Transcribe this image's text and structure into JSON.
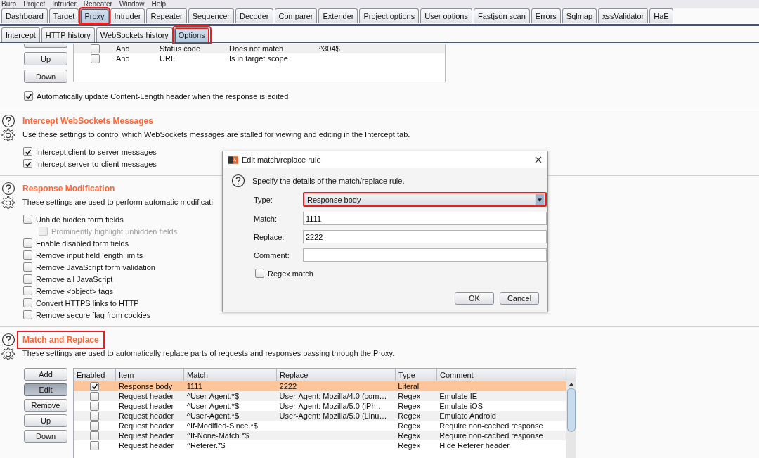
{
  "menu_bar": [
    "Burp",
    "Project",
    "Intruder",
    "Repeater",
    "Window",
    "Help"
  ],
  "tabs": [
    {
      "label": "Dashboard",
      "selected": false,
      "highlighted": false
    },
    {
      "label": "Target",
      "selected": false,
      "highlighted": false
    },
    {
      "label": "Proxy",
      "selected": true,
      "highlighted": true
    },
    {
      "label": "Intruder",
      "selected": false,
      "highlighted": false
    },
    {
      "label": "Repeater",
      "selected": false,
      "highlighted": false
    },
    {
      "label": "Sequencer",
      "selected": false,
      "highlighted": false
    },
    {
      "label": "Decoder",
      "selected": false,
      "highlighted": false
    },
    {
      "label": "Comparer",
      "selected": false,
      "highlighted": false
    },
    {
      "label": "Extender",
      "selected": false,
      "highlighted": false
    },
    {
      "label": "Project options",
      "selected": false,
      "highlighted": false
    },
    {
      "label": "User options",
      "selected": false,
      "highlighted": false
    },
    {
      "label": "Fastjson scan",
      "selected": false,
      "highlighted": false
    },
    {
      "label": "Errors",
      "selected": false,
      "highlighted": false
    },
    {
      "label": "Sqlmap",
      "selected": false,
      "highlighted": false
    },
    {
      "label": "xssValidator",
      "selected": false,
      "highlighted": false
    },
    {
      "label": "HaE",
      "selected": false,
      "highlighted": false
    }
  ],
  "subtabs": [
    {
      "label": "Intercept",
      "selected": false,
      "highlighted": false
    },
    {
      "label": "HTTP history",
      "selected": false,
      "highlighted": false
    },
    {
      "label": "WebSockets history",
      "selected": false,
      "highlighted": false
    },
    {
      "label": "Options",
      "selected": true,
      "highlighted": true
    }
  ],
  "response_rules": {
    "buttons": [
      "Up",
      "Down"
    ],
    "rows": [
      {
        "enabled": false,
        "operator": "And",
        "match_type": "Status code",
        "relationship": "Does not match",
        "condition": "^304$"
      },
      {
        "enabled": false,
        "operator": "And",
        "match_type": "URL",
        "relationship": "Is in target scope"
      }
    ]
  },
  "auto_update": {
    "label": "Automatically update Content-Length header when the response is edited",
    "checked": true
  },
  "sections": [
    {
      "title": "Intercept WebSockets Messages",
      "description": "Use these settings to control which WebSockets messages are stalled for viewing and editing in the Intercept tab.",
      "options": [
        {
          "label": "Intercept client-to-server messages",
          "checked": true,
          "disabled": false
        },
        {
          "label": "Intercept server-to-client messages",
          "checked": true,
          "disabled": false
        }
      ]
    },
    {
      "title": "Response Modification",
      "description": "These settings are used to perform automatic modificati",
      "options": [
        {
          "label": "Unhide hidden form fields",
          "checked": false,
          "disabled": false,
          "children": [
            {
              "label": "Prominently highlight unhidden fields",
              "checked": false,
              "disabled": true
            }
          ]
        },
        {
          "label": "Enable disabled form fields",
          "checked": false,
          "disabled": false
        },
        {
          "label": "Remove input field length limits",
          "checked": false,
          "disabled": false
        },
        {
          "label": "Remove JavaScript form validation",
          "checked": false,
          "disabled": false
        },
        {
          "label": "Remove all JavaScript",
          "checked": false,
          "disabled": false
        },
        {
          "label": "Remove <object> tags",
          "checked": false,
          "disabled": false
        },
        {
          "label": "Convert HTTPS links to HTTP",
          "checked": false,
          "disabled": false
        },
        {
          "label": "Remove secure flag from cookies",
          "checked": false,
          "disabled": false
        }
      ]
    }
  ],
  "match_replace": {
    "title": "Match and Replace",
    "highlighted": true,
    "description": "These settings are used to automatically replace parts of requests and responses passing through the Proxy.",
    "buttons": [
      {
        "label": "Add",
        "selected": false
      },
      {
        "label": "Edit",
        "selected": true
      },
      {
        "label": "Remove",
        "selected": false
      },
      {
        "label": "Up",
        "selected": false
      },
      {
        "label": "Down",
        "selected": false
      }
    ],
    "columns": [
      "Enabled",
      "Item",
      "Match",
      "Replace",
      "Type",
      "Comment"
    ],
    "rows": [
      {
        "enabled": true,
        "selected": true,
        "item": "Response body",
        "match": "1111",
        "replace": "2222",
        "type": "Literal",
        "comment": ""
      },
      {
        "enabled": false,
        "selected": false,
        "item": "Request header",
        "match": "^User-Agent.*$",
        "replace": "User-Agent: Mozilla/4.0 (com…",
        "type": "Regex",
        "comment": "Emulate IE"
      },
      {
        "enabled": false,
        "selected": false,
        "item": "Request header",
        "match": "^User-Agent.*$",
        "replace": "User-Agent: Mozilla/5.0 (iPh…",
        "type": "Regex",
        "comment": "Emulate iOS"
      },
      {
        "enabled": false,
        "selected": false,
        "item": "Request header",
        "match": "^User-Agent.*$",
        "replace": "User-Agent: Mozilla/5.0 (Linu…",
        "type": "Regex",
        "comment": "Emulate Android"
      },
      {
        "enabled": false,
        "selected": false,
        "item": "Request header",
        "match": "^If-Modified-Since.*$",
        "replace": "",
        "type": "Regex",
        "comment": "Require non-cached response"
      },
      {
        "enabled": false,
        "selected": false,
        "item": "Request header",
        "match": "^If-None-Match.*$",
        "replace": "",
        "type": "Regex",
        "comment": "Require non-cached response"
      },
      {
        "enabled": false,
        "selected": false,
        "item": "Request header",
        "match": "^Referer.*$",
        "replace": "",
        "type": "Regex",
        "comment": "Hide Referer header"
      }
    ]
  },
  "dialog": {
    "title": "Edit match/replace rule",
    "prompt": "Specify the details of the match/replace rule.",
    "fields": [
      {
        "kind": "select",
        "label": "Type:",
        "value": "Response body",
        "highlighted": true
      },
      {
        "kind": "text",
        "label": "Match:",
        "value": "1111",
        "highlighted": false
      },
      {
        "kind": "text",
        "label": "Replace:",
        "value": "2222",
        "highlighted": false
      },
      {
        "kind": "text",
        "label": "Comment:",
        "highlighted": false
      }
    ],
    "regex": {
      "label": "Regex match",
      "checked": false
    },
    "buttons": [
      "OK",
      "Cancel"
    ]
  }
}
